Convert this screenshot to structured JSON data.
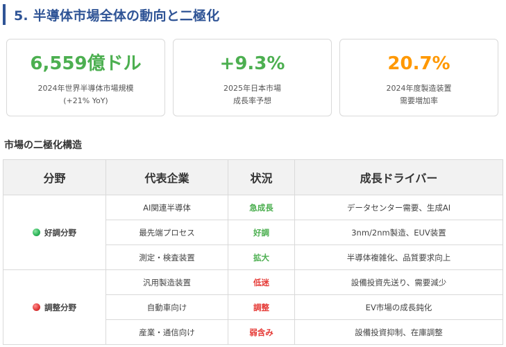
{
  "section": {
    "title": "5. 半導体市場全体の動向と二極化"
  },
  "colors": {
    "title": "#2f5496",
    "green": "#4caf50",
    "orange": "#ff9800",
    "red": "#e53935"
  },
  "cards": [
    {
      "value": "6,559億ドル",
      "label_line1": "2024年世界半導体市場規模",
      "label_line2": "(+21% YoY)",
      "color": "#4caf50"
    },
    {
      "value": "+9.3%",
      "label_line1": "2025年日本市場",
      "label_line2": "成長率予想",
      "color": "#4caf50"
    },
    {
      "value": "20.7%",
      "label_line1": "2024年度製造装置",
      "label_line2": "需要増加率",
      "color": "#ff9800"
    }
  ],
  "structure": {
    "heading": "市場の二極化構造",
    "columns": [
      "分野",
      "代表企業",
      "状況",
      "成長ドライバー"
    ],
    "groups": [
      {
        "segment": "好調分野",
        "dot": "green",
        "rows": [
          {
            "company": "AI関連半導体",
            "status": "急成長",
            "driver": "データセンター需要、生成AI",
            "status_color": "#4caf50"
          },
          {
            "company": "最先端プロセス",
            "status": "好調",
            "driver": "3nm/2nm製造、EUV装置",
            "status_color": "#4caf50"
          },
          {
            "company": "測定・検査装置",
            "status": "拡大",
            "driver": "半導体複雑化、品質要求向上",
            "status_color": "#4caf50"
          }
        ]
      },
      {
        "segment": "調整分野",
        "dot": "red",
        "rows": [
          {
            "company": "汎用製造装置",
            "status": "低迷",
            "driver": "設備投資先送り、需要減少",
            "status_color": "#e53935"
          },
          {
            "company": "自動車向け",
            "status": "調整",
            "driver": "EV市場の成長鈍化",
            "status_color": "#e53935"
          },
          {
            "company": "産業・通信向け",
            "status": "弱含み",
            "driver": "設備投資抑制、在庫調整",
            "status_color": "#e53935"
          }
        ]
      }
    ]
  }
}
